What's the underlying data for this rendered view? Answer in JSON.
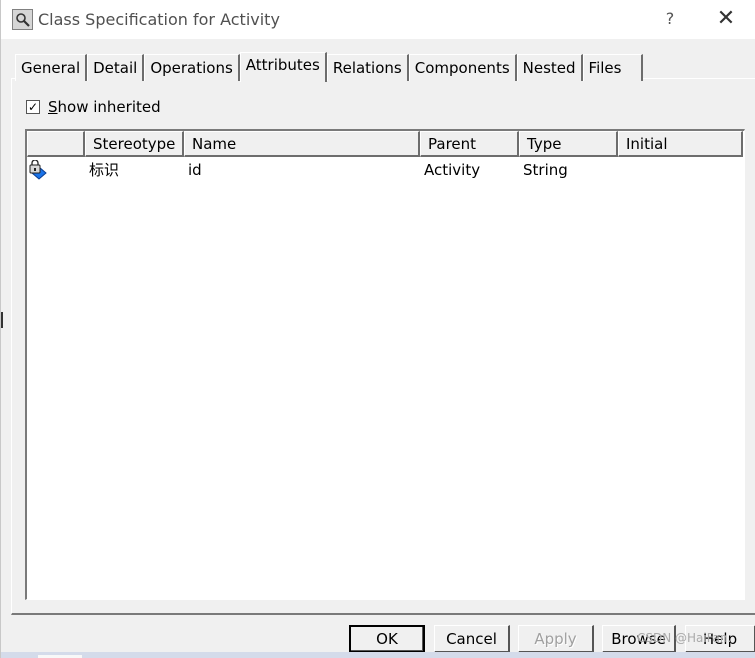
{
  "window": {
    "title": "Class Specification for Activity",
    "help_glyph": "?",
    "close_glyph": "✕",
    "title_icon": "magnifier-icon"
  },
  "tabs": [
    {
      "label": "General"
    },
    {
      "label": "Detail"
    },
    {
      "label": "Operations"
    },
    {
      "label": "Attributes",
      "active": true
    },
    {
      "label": "Relations"
    },
    {
      "label": "Components"
    },
    {
      "label": "Nested"
    },
    {
      "label": "Files"
    }
  ],
  "show_inherited": {
    "checked": true,
    "mark": "✓",
    "label_underlined": "S",
    "label_rest": "how inherited"
  },
  "attributes_table": {
    "columns": [
      "",
      "Stereotype",
      "Name",
      "Parent",
      "Type",
      "Initial"
    ],
    "rows": [
      {
        "icon": "protected-attribute-icon",
        "stereotype": "标识",
        "name": "id",
        "parent": "Activity",
        "type": "String",
        "initial": ""
      }
    ]
  },
  "buttons": {
    "ok": "OK",
    "cancel": "Cancel",
    "apply": "Apply",
    "browse": "Browse",
    "help": "Help"
  },
  "watermark": "CSDN @HaiFan."
}
